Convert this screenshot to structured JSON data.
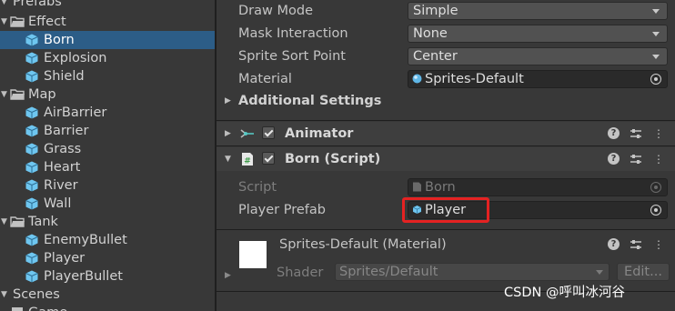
{
  "project": {
    "items": [
      {
        "label": "Prefabs"
      },
      {
        "label": "Effect"
      },
      {
        "label": "Born"
      },
      {
        "label": "Explosion"
      },
      {
        "label": "Shield"
      },
      {
        "label": "Map"
      },
      {
        "label": "AirBarrier"
      },
      {
        "label": "Barrier"
      },
      {
        "label": "Grass"
      },
      {
        "label": "Heart"
      },
      {
        "label": "River"
      },
      {
        "label": "Wall"
      },
      {
        "label": "Tank"
      },
      {
        "label": "EnemyBullet"
      },
      {
        "label": "Player"
      },
      {
        "label": "PlayerBullet"
      },
      {
        "label": "Scenes"
      },
      {
        "label": "Game"
      }
    ],
    "selected": "Born"
  },
  "inspector": {
    "sprite_renderer": {
      "draw_mode_label": "Draw Mode",
      "draw_mode_value": "Simple",
      "mask_label": "Mask Interaction",
      "mask_value": "None",
      "sort_label": "Sprite Sort Point",
      "sort_value": "Center",
      "material_label": "Material",
      "material_value": "Sprites-Default",
      "additional_settings": "Additional Settings"
    },
    "animator": {
      "title": "Animator"
    },
    "born_script": {
      "title": "Born (Script)",
      "script_label": "Script",
      "script_value": "Born",
      "player_prefab_label": "Player Prefab",
      "player_prefab_value": "Player"
    },
    "material_panel": {
      "title": "Sprites-Default (Material)",
      "shader_label": "Shader",
      "shader_value": "Sprites/Default",
      "edit_label": "Edit..."
    },
    "help_glyph": "?",
    "menu_glyph": "⋮"
  },
  "watermark": "CSDN @呼叫冰河谷",
  "colors": {
    "selection": "#2c5d87",
    "highlight_border": "#e52222",
    "prefab_icon": "#6ec6f0",
    "panel_bg": "#383838"
  }
}
